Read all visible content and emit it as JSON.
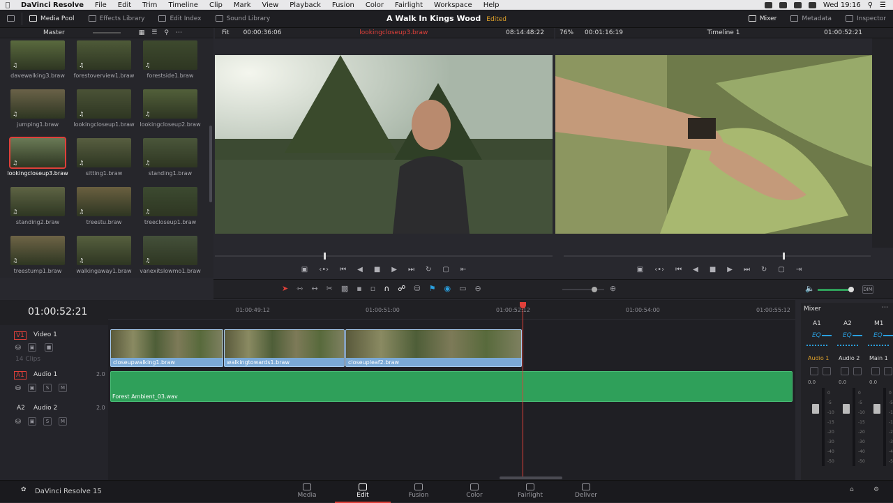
{
  "menubar": {
    "app": "DaVinci Resolve",
    "items": [
      "File",
      "Edit",
      "Trim",
      "Timeline",
      "Clip",
      "Mark",
      "View",
      "Playback",
      "Fusion",
      "Color",
      "Fairlight",
      "Workspace",
      "Help"
    ],
    "clock": "Wed 19:16"
  },
  "toolbar": {
    "media_pool": "Media Pool",
    "effects": "Effects Library",
    "edit_index": "Edit Index",
    "sound": "Sound Library",
    "project": "A Walk In Kings Wood",
    "status": "Edited",
    "mixer": "Mixer",
    "metadata": "Metadata",
    "inspector": "Inspector"
  },
  "header": {
    "bin": "Master",
    "fit": "Fit",
    "src_dur": "00:00:36:06",
    "clip": "lookingcloseup3.braw",
    "src_tc": "08:14:48:22",
    "zoom": "76%",
    "tl_dur": "00:01:16:19",
    "timeline": "Timeline 1",
    "tl_tc": "01:00:52:21"
  },
  "pool": {
    "clips": [
      "davewalking3.braw",
      "forestoverview1.braw",
      "forestside1.braw",
      "jumping1.braw",
      "lookingcloseup1.braw",
      "lookingcloseup2.braw",
      "lookingcloseup3.braw",
      "sitting1.braw",
      "standing1.braw",
      "standing2.braw",
      "treestu.braw",
      "treecloseup1.braw",
      "treestump1.braw",
      "walkingaway1.braw",
      "vanexitslowmo1.braw"
    ]
  },
  "timecode": "01:00:52:21",
  "ruler": [
    "01:00:49:12",
    "01:00:51:00",
    "01:00:52:12",
    "01:00:54:00",
    "01:00:55:12"
  ],
  "tracks": {
    "v1": {
      "id": "V1",
      "name": "Video 1",
      "clips": "14 Clips"
    },
    "a1": {
      "id": "A1",
      "name": "Audio 1",
      "ch": "2.0"
    },
    "a2": {
      "id": "A2",
      "name": "Audio 2",
      "ch": "2.0"
    }
  },
  "clips": [
    "closeupwalking1.braw",
    "walkingtowards1.braw",
    "closeupleaf2.braw"
  ],
  "audio_clip": "Forest Ambient_03.wav",
  "mixer": {
    "title": "Mixer",
    "chans": [
      "A1",
      "A2",
      "M1"
    ],
    "eq": "EQ",
    "names": [
      "Audio 1",
      "Audio 2",
      "Main 1"
    ],
    "levels": [
      "0.0",
      "0.0",
      "0.0"
    ],
    "scale": [
      "0",
      "-5",
      "-10",
      "-15",
      "-20",
      "-30",
      "-40",
      "-50"
    ]
  },
  "pages": [
    "Media",
    "Edit",
    "Fusion",
    "Color",
    "Fairlight",
    "Deliver"
  ],
  "brand": "DaVinci Resolve 15",
  "colors": {
    "accent_red": "#e0403a",
    "status_orange": "#e0a22a",
    "clip_blue": "#7aa9d6",
    "audio_green": "#2fa05a",
    "mixer_blue": "#2aa0e0"
  }
}
